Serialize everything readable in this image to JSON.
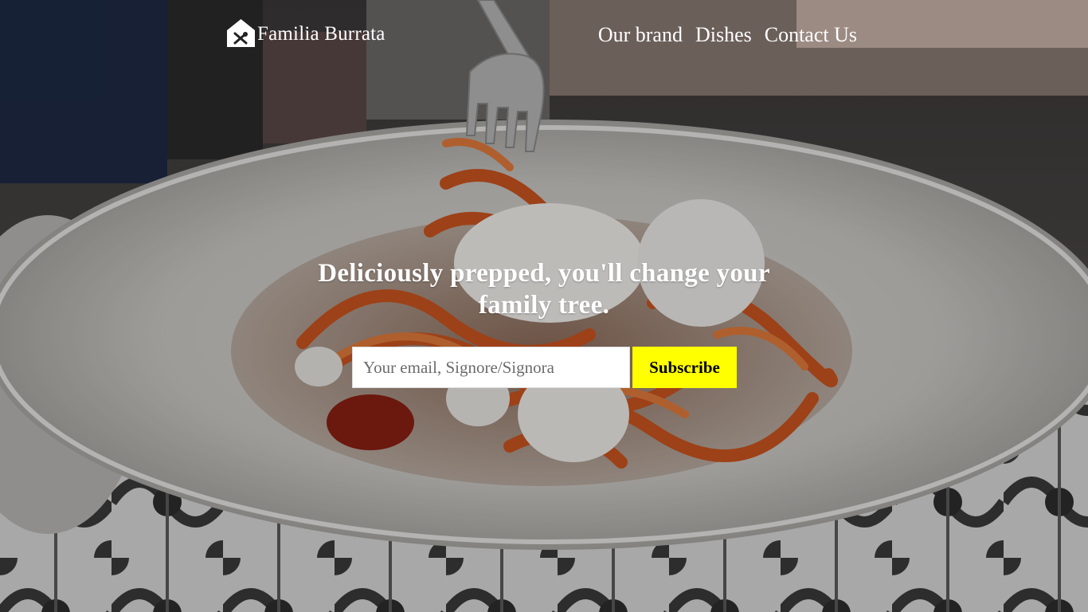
{
  "brand": {
    "name": "Familia Burrata",
    "icon": "house-utensils-icon"
  },
  "nav": {
    "items": [
      {
        "label": "Our brand"
      },
      {
        "label": "Dishes"
      },
      {
        "label": "Contact Us"
      }
    ]
  },
  "hero": {
    "headline": "Deliciously prepped, you'll change your family tree.",
    "background": "pasta-with-burrata-photo"
  },
  "subscribe": {
    "placeholder": "Your email, Signore/Signora",
    "button_label": "Subscribe"
  },
  "colors": {
    "accent": "#ffff00",
    "text": "#ffffff"
  }
}
